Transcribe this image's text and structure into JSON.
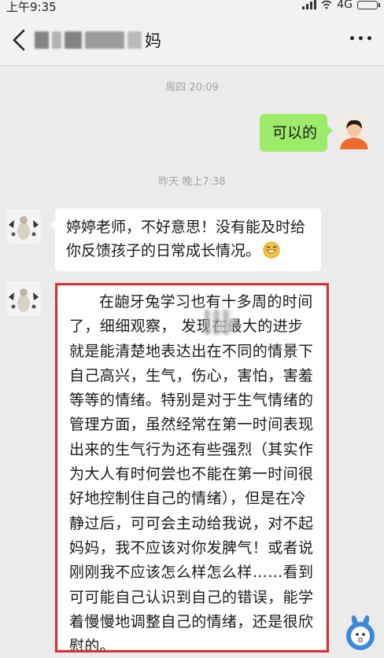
{
  "status_bar": {
    "time": "上午9:35",
    "network": "4G"
  },
  "header": {
    "contact_name_suffix": "妈"
  },
  "messages": {
    "time_1": "周四 20:09",
    "outgoing_1": "可以的",
    "time_2": "昨天 晚上7:38",
    "incoming_1": "婷婷老师，不好意思！没有能及时给你反馈孩子的日常成长情况。",
    "incoming_2": "在龅牙兔学习也有十多周的时间了，细细观察，    发现在最大的进步就是能清楚地表达出在不同的情景下自己高兴，生气，伤心，害怕，害羞等等的情绪。特别是对于生气情绪的管理方面，虽然经常在第一时间表现出来的生气行为还有些强烈（其实作为大人有时何尝也不能在第一时间很好地控制住自己的情绪），但是在冷静过后，可可会主动给我说，对不起妈妈，我不应该对你发脾气！或者说刚刚我不应该怎么样怎么样……看到可可能自己认识到自己的错误，能学着慢慢地调整自己的情绪，还是很欣慰的。"
  },
  "colors": {
    "outgoing_bubble": "#9eea6a",
    "incoming_bubble": "#ffffff",
    "background": "#ebebeb",
    "highlight_border": "#d7302d"
  },
  "icons": {
    "back": "chevron-left-icon",
    "more": "more-dots-icon",
    "emoji": "grinning-sweat-emoji",
    "watermark": "bunny-logo"
  }
}
